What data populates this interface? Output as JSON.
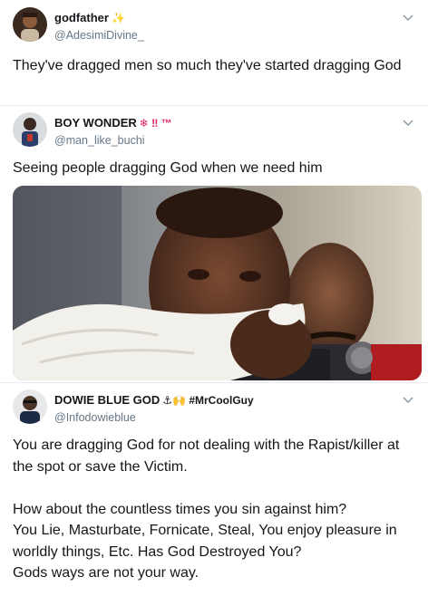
{
  "tweets": [
    {
      "display_name": "godfather",
      "badge": "✨",
      "handle": "@AdesimiDivine_",
      "text": "They've dragged men so much they've started dragging God"
    },
    {
      "display_name": "BOY WONDER",
      "badge": "❄ ‼ ™",
      "handle": "@man_like_buchi",
      "text": "Seeing people dragging God when we need him",
      "media_icon": "photo-of-man-crying-into-towel"
    },
    {
      "display_name": "DOWIE BLUE GOD",
      "badge": "⚓🙌 #MrCoolGuy",
      "handle": "@Infodowieblue",
      "text": "You are dragging God for not dealing with the Rapist/killer at the spot or save the Victim.\n\nHow about the countless times you sin against him?\nYou Lie, Masturbate, Fornicate, Steal, You enjoy pleasure in worldly things, Etc. Has God Destroyed You?\nGods ways are not your way."
    }
  ],
  "colors": {
    "text": "#14171a",
    "secondary": "#657786",
    "divider": "#e6ecf0",
    "caret": "#8899a6",
    "badge_gold": "#f5b800",
    "badge_red": "#e0245e"
  }
}
